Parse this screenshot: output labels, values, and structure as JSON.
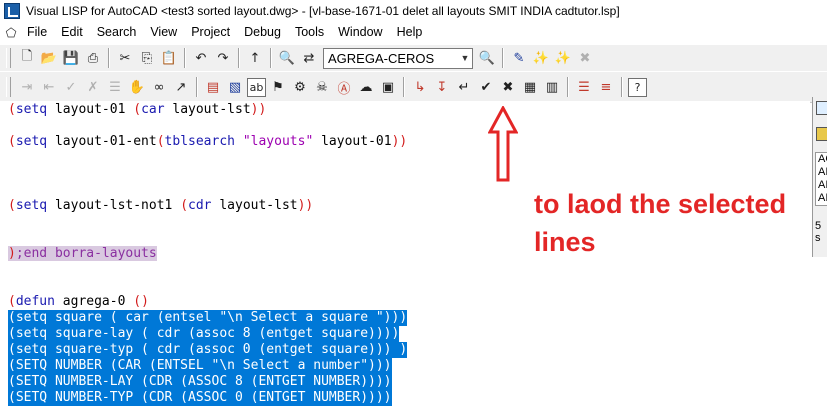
{
  "window": {
    "title": "Visual LISP for AutoCAD <test3 sorted layout.dwg> - [vl-base-1671-01 delet all layouts  SMIT INDIA  cadtutor.lsp]"
  },
  "menu": {
    "items": [
      {
        "label": "File"
      },
      {
        "label": "Edit"
      },
      {
        "label": "Search"
      },
      {
        "label": "View"
      },
      {
        "label": "Project"
      },
      {
        "label": "Debug"
      },
      {
        "label": "Tools"
      },
      {
        "label": "Window"
      },
      {
        "label": "Help"
      }
    ]
  },
  "toolbar": {
    "search_combo_value": "AGREGA-CEROS",
    "icons_row1": [
      "new-file-icon",
      "open-file-icon",
      "save-icon",
      "print-icon",
      "cut-icon",
      "copy-icon",
      "paste-icon",
      "undo-icon",
      "redo-icon",
      "complete-word-icon",
      "find-icon",
      "replace-icon",
      "toggle-bookmark-icon",
      "next-bookmark-icon",
      "prev-bookmark-icon",
      "clear-bookmarks-icon"
    ],
    "icons_row2": [
      "indent-icon",
      "unindent-icon",
      "comment-block-icon",
      "uncomment-block-icon",
      "format-icon",
      "pan-hand-icon",
      "inspect-icon",
      "load-selection-icon",
      "load-file-icon",
      "check-selection-icon",
      "check-file-icon",
      "activate-autocad-icon",
      "step-into-icon",
      "step-over-icon",
      "step-out-icon",
      "continue-icon",
      "quit-icon",
      "reset-icon",
      "toggle-breakpoint-icon",
      "add-watch-icon",
      "last-break-icon",
      "help-icon"
    ]
  },
  "editor": {
    "lines": [
      {
        "text": "(setq layout-01 (car layout-lst))",
        "selected": false
      },
      {
        "text": "(setq layout-01-ent(tblsearch \"layouts\" layout-01))",
        "selected": false
      },
      {
        "text": "(setq layout-lst-not1 (cdr layout-lst))",
        "selected": false
      },
      {
        "text": ");end borra-layouts",
        "selected": false
      },
      {
        "text": "(defun agrega-0 ()",
        "selected": false
      },
      {
        "text": "(setq square ( car (entsel \"\\n Select a square \")))",
        "selected": true
      },
      {
        "text": "(setq square-lay ( cdr (assoc 8 (entget square))))",
        "selected": true
      },
      {
        "text": "(setq square-typ ( cdr (assoc 0 (entget square))) )",
        "selected": true
      },
      {
        "text": "(SETQ NUMBER (CAR (ENTSEL \"\\n Select a number\")))",
        "selected": true
      },
      {
        "text": "(SETQ NUMBER-LAY (CDR (ASSOC 8 (ENTGET NUMBER))))",
        "selected": true
      },
      {
        "text": "(SETQ NUMBER-TYP (CDR (ASSOC 0 (ENTGET NUMBER))))",
        "selected": true
      }
    ]
  },
  "annotation": {
    "line1": "to laod the selected",
    "line2": "lines",
    "color": "#e32626"
  },
  "side_panel": {
    "items": [
      "AG",
      "AI",
      "AI",
      "AI"
    ],
    "status": "5 s"
  },
  "colors": {
    "selection": "#0078d7",
    "paren": "#d21b1b",
    "keyword": "#1a1ab0",
    "string": "#9c00b0"
  }
}
